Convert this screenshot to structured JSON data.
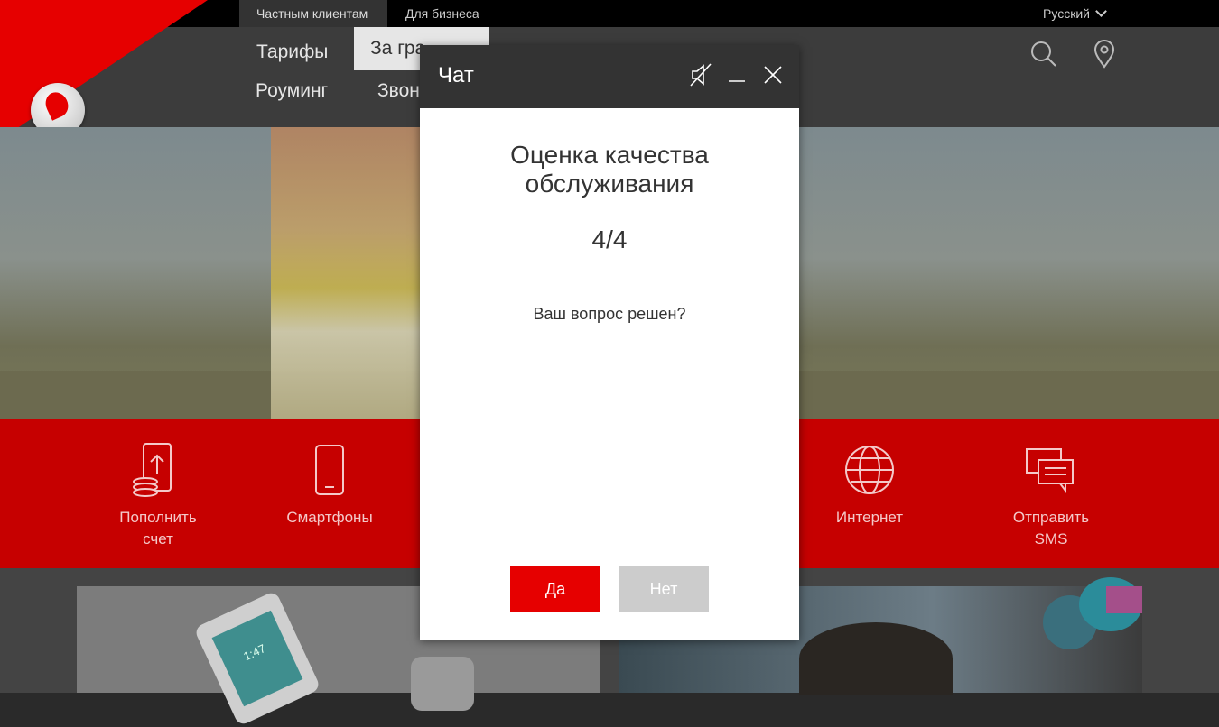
{
  "topbar": {
    "segments": [
      "Частным клиентам",
      "Для бизнеса"
    ],
    "language": "Русский"
  },
  "nav": {
    "row1": [
      "Тарифы",
      "За гра"
    ],
    "row2": [
      "Роуминг",
      "Звон"
    ]
  },
  "tiles": [
    {
      "label_line1": "Пополнить",
      "label_line2": "счет",
      "icon": "phone-topup-icon"
    },
    {
      "label_line1": "Смартфоны",
      "label_line2": "",
      "icon": "smartphone-icon"
    },
    {
      "label_line1": "Интернет",
      "label_line2": "",
      "icon": "globe-icon"
    },
    {
      "label_line1": "Отправить",
      "label_line2": "SMS",
      "icon": "chat-bubbles-icon"
    }
  ],
  "promo": {
    "phone_time": "1:47"
  },
  "chat": {
    "title": "Чат",
    "survey_title_line1": "Оценка качества",
    "survey_title_line2": "обслуживания",
    "step": "4/4",
    "question": "Ваш вопрос решен?",
    "yes_label": "Да",
    "no_label": "Нет"
  },
  "colors": {
    "brand_red": "#e60000",
    "band_red": "#c60000",
    "nav_dark": "#3c3c3c",
    "button_disabled": "#cccccc"
  }
}
